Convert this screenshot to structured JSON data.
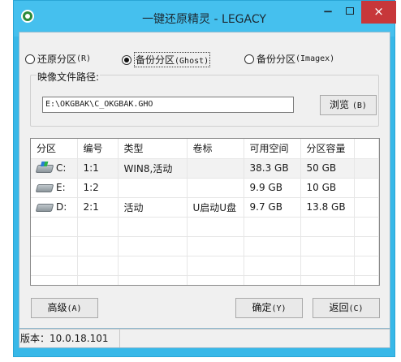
{
  "window": {
    "title": "一键还原精灵 - LEGACY",
    "minimize": "−",
    "close": "×",
    "accent": "#38b8e8",
    "close_color": "#c7373a"
  },
  "modes": [
    {
      "label": "还原分区",
      "key": "(R)",
      "selected": false
    },
    {
      "label": "备份分区",
      "key": "(Ghost)",
      "selected": true
    },
    {
      "label": "备份分区",
      "key": "(Imagex)",
      "selected": false
    }
  ],
  "image_path": {
    "label": "映像文件路径:",
    "value": "E:\\OKGBAK\\C_OKGBAK.GHO",
    "browse_label": "浏览",
    "browse_key": "(B)"
  },
  "partitions": {
    "columns": [
      "分区",
      "编号",
      "类型",
      "卷标",
      "可用空间",
      "分区容量"
    ],
    "rows": [
      {
        "drive": "C:",
        "number": "1:1",
        "type": "WIN8,活动",
        "label": "",
        "free": "38.3 GB",
        "capacity": "50 GB",
        "icon": "system-drive-icon"
      },
      {
        "drive": "E:",
        "number": "1:2",
        "type": "",
        "label": "",
        "free": "9.9 GB",
        "capacity": "10 GB",
        "icon": "drive-icon"
      },
      {
        "drive": "D:",
        "number": "2:1",
        "type": "活动",
        "label": "U启动U盘",
        "free": "9.7 GB",
        "capacity": "13.8 GB",
        "icon": "drive-icon"
      }
    ]
  },
  "buttons": {
    "advanced": "高级",
    "advanced_key": "(A)",
    "ok": "确定",
    "ok_key": "(Y)",
    "back": "返回",
    "back_key": "(C)"
  },
  "status": {
    "version": "版本：10.0.18.101"
  }
}
